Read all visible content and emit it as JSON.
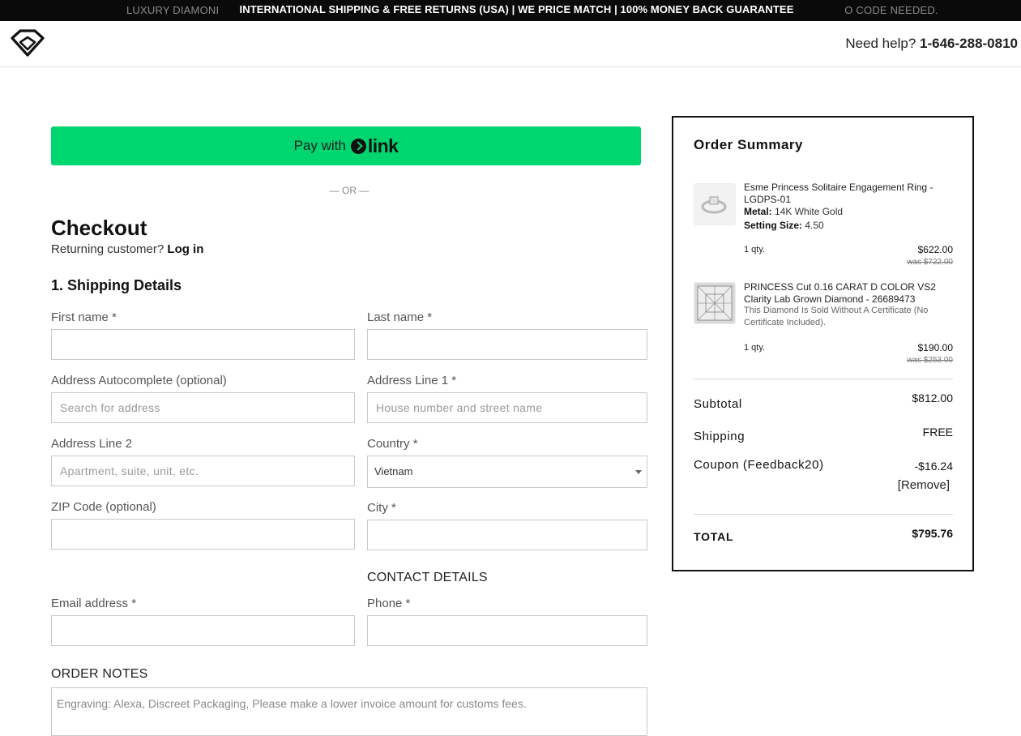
{
  "announcement": {
    "ghost_left": "LUXURY DIAMONI",
    "ghost_right": "O CODE NEEDED.",
    "text": "INTERNATIONAL SHIPPING & FREE RETURNS (USA)  |  WE PRICE MATCH  |  100% MONEY BACK GUARANTEE"
  },
  "header": {
    "logo_icon": "diamond-logo",
    "help_label": "Need help?",
    "help_phone": "1-646-288-0810"
  },
  "express_pay": {
    "pay_label": "Pay with",
    "brand": "link",
    "brand_color": "#00d66f",
    "separator": "— OR —"
  },
  "checkout": {
    "title": "Checkout",
    "returning_label": "Returning customer?",
    "login_label": "Log in",
    "shipping_heading": "1. Shipping Details"
  },
  "form": {
    "first_name": {
      "label": "First name *",
      "value": ""
    },
    "last_name": {
      "label": "Last name *",
      "value": ""
    },
    "address_autocomplete": {
      "label": "Address Autocomplete (optional)",
      "placeholder": "Search for address"
    },
    "address_line1": {
      "label": "Address Line 1 *",
      "placeholder": "House number and street name"
    },
    "address_line2": {
      "label": "Address Line 2",
      "placeholder": "Apartment, suite, unit, etc."
    },
    "country": {
      "label": "Country *",
      "value": "Vietnam"
    },
    "zip": {
      "label": "ZIP Code (optional)",
      "value": ""
    },
    "city": {
      "label": "City *",
      "value": ""
    },
    "contact_heading": "CONTACT DETAILS",
    "email": {
      "label": "Email address *",
      "value": ""
    },
    "phone": {
      "label": "Phone *",
      "value": ""
    },
    "notes_heading": "ORDER NOTES",
    "notes": {
      "placeholder": "Engraving: Alexa, Discreet Packaging, Please make a lower invoice amount for customs fees."
    }
  },
  "summary": {
    "title": "Order Summary",
    "items": [
      {
        "name": "Esme Princess Solitaire Engagement Ring - LGDPS-01",
        "metal_label": "Metal:",
        "metal_value": "14K White Gold",
        "size_label": "Setting Size:",
        "size_value": "4.50",
        "qty": "1 qty.",
        "price": "$622.00",
        "was": "was $722.00",
        "icon": "ring-thumbnail"
      },
      {
        "name": "PRINCESS Cut 0.16 CARAT D COLOR VS2 Clarity Lab Grown Diamond - 26689473",
        "note": "This Diamond Is Sold Without A Certificate (No Certificate Included).",
        "qty": "1 qty.",
        "price": "$190.00",
        "was": "was $253.00",
        "icon": "diamond-thumbnail"
      }
    ],
    "subtotal_label": "Subtotal",
    "subtotal_value": "$812.00",
    "shipping_label": "Shipping",
    "shipping_value": "FREE",
    "coupon_label": "Coupon (Feedback20)",
    "coupon_value": "-$16.24",
    "remove_label": "[Remove]",
    "total_label": "TOTAL",
    "total_value": "$795.76"
  }
}
